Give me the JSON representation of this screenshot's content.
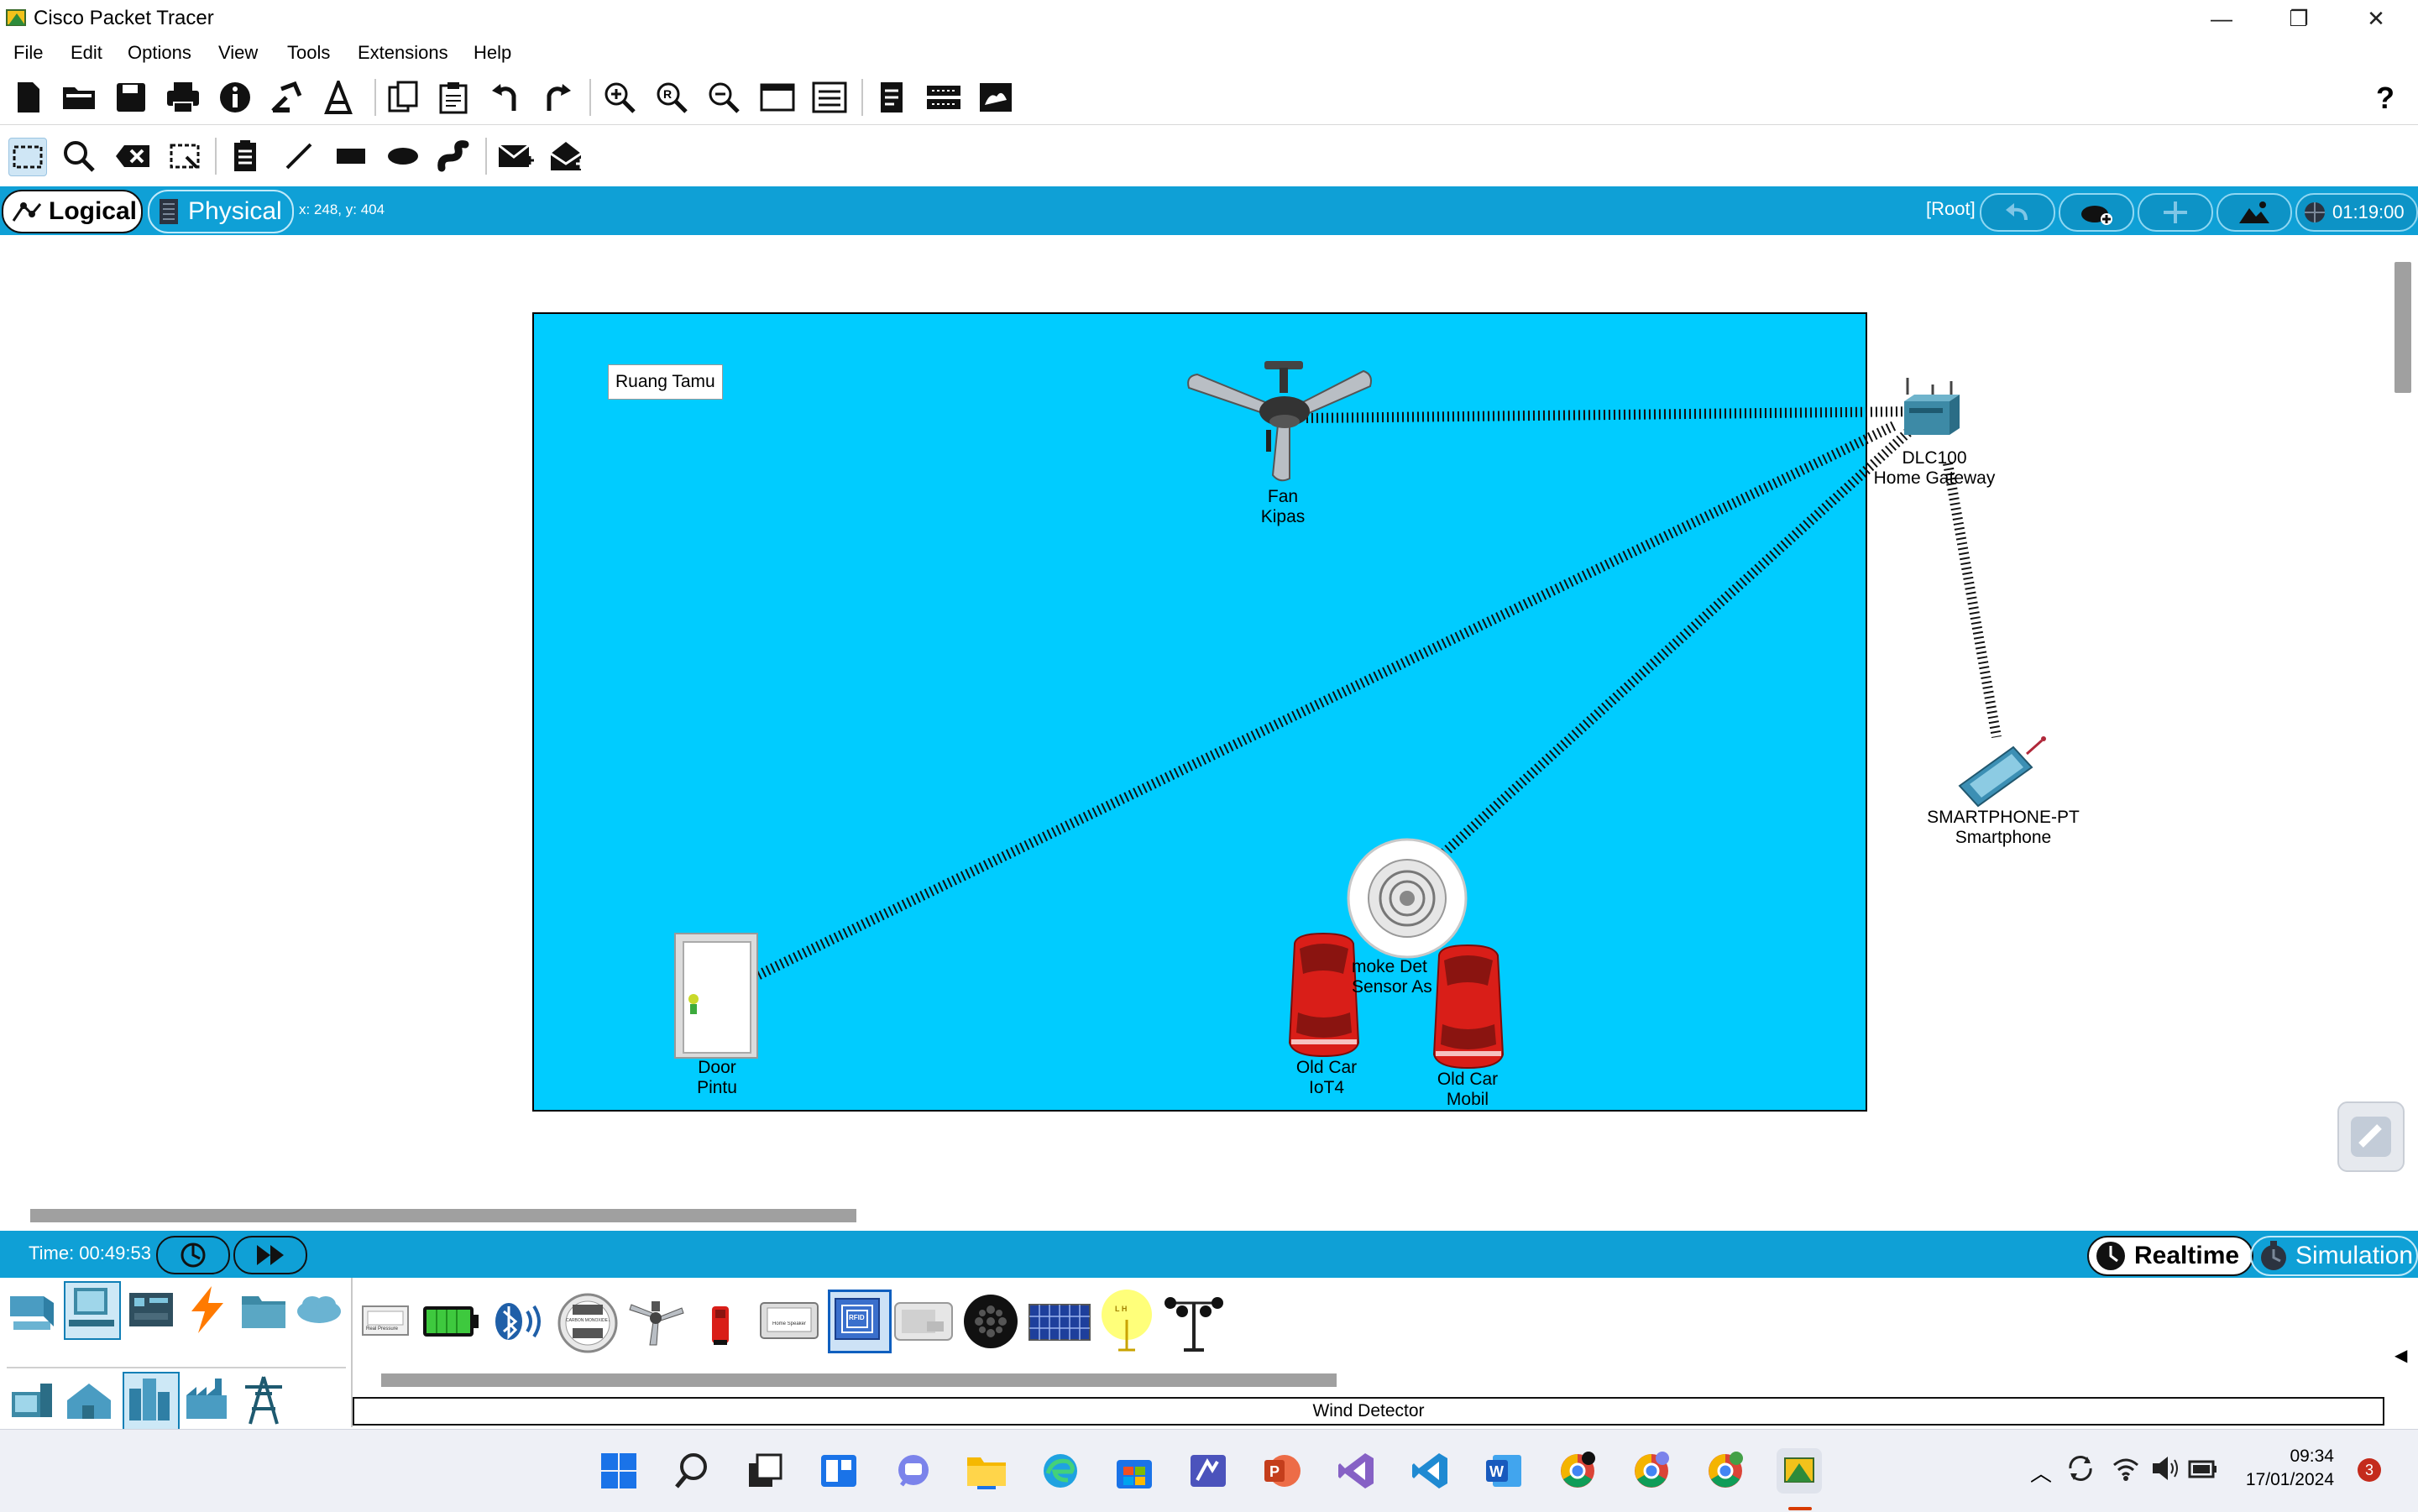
{
  "window": {
    "title": "Cisco Packet Tracer",
    "minimize": "—",
    "maximize": "❐",
    "close": "✕"
  },
  "menu": [
    "File",
    "Edit",
    "Options",
    "View",
    "Tools",
    "Extensions",
    "Help"
  ],
  "toolbar1": {
    "icons": [
      "new-file-icon",
      "open-folder-icon",
      "save-icon",
      "print-icon",
      "info-icon",
      "activity-wizard-icon",
      "custom-device-icon",
      "copy-icon",
      "paste-icon",
      "undo-icon",
      "redo-icon",
      "zoom-in-icon",
      "zoom-reset-icon",
      "zoom-out-icon",
      "drawing-palette-icon",
      "custom-devices-dialog-icon",
      "pdu-list-icon",
      "cluster-icon",
      "network-info-icon"
    ],
    "help": "?"
  },
  "toolbar2": {
    "icons": [
      "select-icon",
      "inspect-icon",
      "delete-icon",
      "resize-shape-icon",
      "place-note-icon",
      "draw-line-icon",
      "draw-rectangle-icon",
      "draw-ellipse-icon",
      "freeform-icon",
      "add-simple-pdu-icon",
      "add-complex-pdu-icon"
    ]
  },
  "modebar": {
    "logical": "Logical",
    "physical": "Physical",
    "coords": "x: 248, y: 404",
    "root": "[Root]",
    "clock": "01:19:00"
  },
  "workspace": {
    "note": "Ruang Tamu",
    "devices": {
      "fan": [
        "Fan",
        "Kipas"
      ],
      "gateway": [
        "DLC100",
        "Home Gateway"
      ],
      "smartphone": [
        "SMARTPHONE-PT",
        "Smartphone"
      ],
      "smoke": [
        "moke Det",
        "Sensor As"
      ],
      "door": [
        "Door",
        "Pintu"
      ],
      "car1": [
        "Old Car",
        "IoT4"
      ],
      "car2": [
        "Old Car",
        "Mobil"
      ]
    }
  },
  "bottombar": {
    "time": "Time: 00:49:53",
    "realtime": "Realtime",
    "simulation": "Simulation"
  },
  "devpanel": {
    "selected_name": "Wind Detector",
    "categories": [
      "network-devices-icon",
      "end-devices-icon",
      "components-icon",
      "connections-icon",
      "miscellaneous-icon",
      "multiuser-icon"
    ],
    "subcategories": [
      "home-icon",
      "smart-city-icon",
      "industrial-icon",
      "power-grid-icon",
      "office-icon"
    ],
    "devices": [
      "Pressure Sensor",
      "Battery",
      "Bluetooth Speaker",
      "Carbon Monoxide Alarm",
      "Ceiling Fan",
      "Fire Sprinkler",
      "Home Speaker",
      "RFID Card",
      "RFID Reader",
      "Siren",
      "Solar Panel",
      "LED Light",
      "Wind Detector"
    ],
    "bt_label": "Real Pressure",
    "co_label": "CARBON MONOXIDE ALARM",
    "speaker_label": "Home Speaker",
    "rfid_label": "RFID",
    "led_label": "L H"
  },
  "taskbar": {
    "time": "09:34",
    "date": "17/01/2024",
    "notifications": "3"
  },
  "colors": {
    "accent": "#0fa0d6",
    "room": "#00ccff",
    "car": "#d91e18"
  }
}
